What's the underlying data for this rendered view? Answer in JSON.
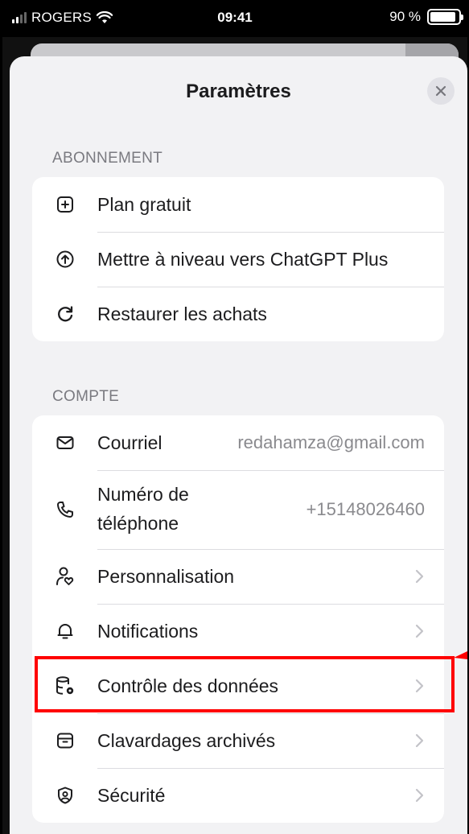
{
  "status_bar": {
    "carrier": "ROGERS",
    "time": "09:41",
    "battery_percent": "90 %",
    "battery_level": 0.9,
    "signal_bars": 2
  },
  "sheet": {
    "title": "Paramètres",
    "close_icon": "xmark-icon"
  },
  "subscription": {
    "header": "ABONNEMENT",
    "items": [
      {
        "icon": "plus-square-icon",
        "label": "Plan gratuit"
      },
      {
        "icon": "arrow-up-circle-icon",
        "label": "Mettre à niveau vers ChatGPT Plus"
      },
      {
        "icon": "restore-icon",
        "label": "Restaurer les achats"
      }
    ]
  },
  "account": {
    "header": "COMPTE",
    "email": {
      "icon": "envelope-icon",
      "label": "Courriel",
      "value": "redahamza@gmail.com"
    },
    "phone": {
      "icon": "phone-icon",
      "label_line1": "Numéro de",
      "label_line2": "téléphone",
      "value": "+15148026460"
    },
    "items": [
      {
        "icon": "person-heart-icon",
        "label": "Personnalisation"
      },
      {
        "icon": "bell-icon",
        "label": "Notifications"
      },
      {
        "icon": "database-gear-icon",
        "label": "Contrôle des données"
      },
      {
        "icon": "archive-icon",
        "label": "Clavardages archivés"
      },
      {
        "icon": "shield-icon",
        "label": "Sécurité"
      }
    ]
  },
  "colors": {
    "highlight": "#ff0000",
    "sheet_bg": "#f2f2f4"
  }
}
